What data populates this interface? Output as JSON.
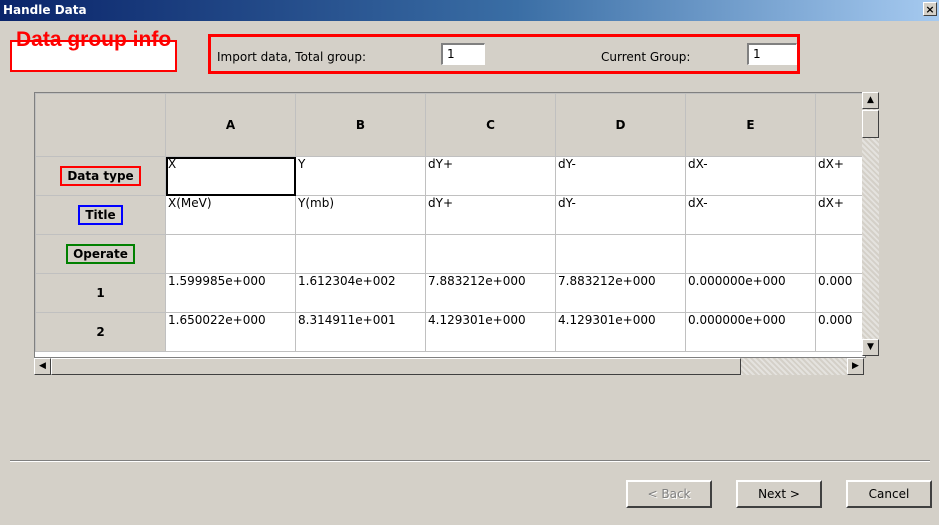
{
  "window": {
    "title": "Handle Data",
    "close_glyph": "×"
  },
  "data_group": {
    "label": "Data group info",
    "total_label": "Import data, Total group:",
    "total_value": "1",
    "current_label": "Current Group:",
    "current_value": "1"
  },
  "grid": {
    "columns": [
      "A",
      "B",
      "C",
      "D",
      "E",
      ""
    ],
    "rows": [
      {
        "header": "Data type",
        "cells": [
          "X",
          "Y",
          "dY+",
          "dY-",
          "dX-",
          "dX+"
        ]
      },
      {
        "header": "Title",
        "cells": [
          "X(MeV)",
          "Y(mb)",
          "dY+",
          "dY-",
          "dX-",
          "dX+"
        ]
      },
      {
        "header": "Operate",
        "cells": [
          "",
          "",
          "",
          "",
          "",
          ""
        ]
      },
      {
        "header": "1",
        "cells": [
          "1.599985e+000",
          "1.612304e+002",
          "7.883212e+000",
          "7.883212e+000",
          "0.000000e+000",
          "0.000"
        ]
      },
      {
        "header": "2",
        "cells": [
          "1.650022e+000",
          "8.314911e+001",
          "4.129301e+000",
          "4.129301e+000",
          "0.000000e+000",
          "0.000"
        ]
      }
    ],
    "row_tag_colors": {
      "Data type": "#ff0000",
      "Title": "#0000ff",
      "Operate": "#008000"
    }
  },
  "buttons": {
    "back": "< Back",
    "next": "Next >",
    "cancel": "Cancel"
  },
  "colors": {
    "highlight": "#ff0000",
    "window_bg": "#d4d0c8",
    "title_bar": "#0a246a"
  }
}
